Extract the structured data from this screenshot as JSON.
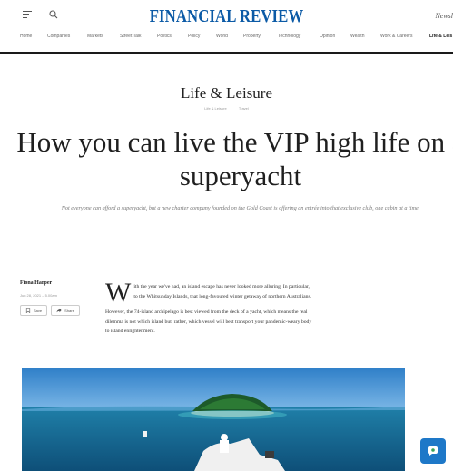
{
  "header": {
    "masthead": "FINANCIAL REVIEW",
    "newsletters": "Newsl"
  },
  "nav": {
    "items": [
      {
        "label": "Home"
      },
      {
        "label": "Companies"
      },
      {
        "label": "Markets"
      },
      {
        "label": "Street Talk"
      },
      {
        "label": "Politics"
      },
      {
        "label": "Policy"
      },
      {
        "label": "World"
      },
      {
        "label": "Property"
      },
      {
        "label": "Technology"
      },
      {
        "label": "Opinion"
      },
      {
        "label": "Wealth"
      },
      {
        "label": "Work & Careers"
      },
      {
        "label": "Life & Leis"
      }
    ],
    "active_index": 12
  },
  "section": {
    "title": "Life & Leisure",
    "tags": [
      "Life & Leisure",
      "Travel"
    ]
  },
  "article": {
    "headline": "How you can live the VIP high life on a superyacht",
    "standfirst": "Not everyone can afford a superyacht, but a new charter company founded on the Gold Coast is offering an entrée into that exclusive club, one cabin at a time.",
    "author": "Fiona Harper",
    "date": "Jun 28, 2021 – 5.00am",
    "save_label": "Save",
    "share_label": "Share",
    "dropcap": "W",
    "para1": "ith the year we've had, an island escape has never looked more alluring. In particular, to the Whitsunday Islands, that long-favoured winter getaway of northern Australians.",
    "para2": "However, the 74-island archipelago is best viewed from the deck of a yacht, which means the real dilemma is not which island but, rather, which vessel will best transport your pandemic-weary body to island enlightenment."
  },
  "icons": {
    "menu": "hamburger-menu-icon",
    "search": "search-icon",
    "save": "bookmark-icon",
    "share": "share-arrow-icon",
    "fab": "chat-icon"
  },
  "colors": {
    "brand": "#0b5aa6",
    "fab": "#1e78c8"
  }
}
